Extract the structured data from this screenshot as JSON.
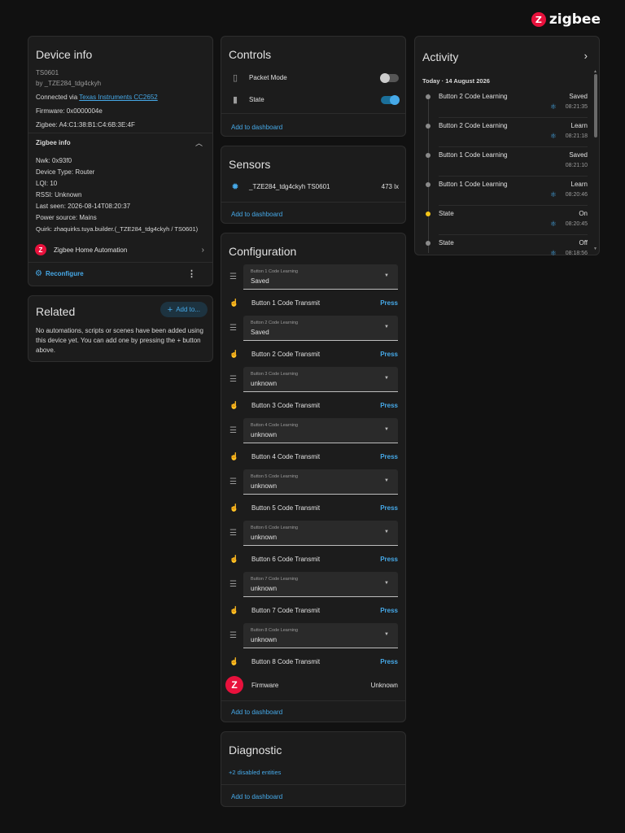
{
  "brand": {
    "name": "zigbee",
    "color": "#e8113c"
  },
  "device_info": {
    "title": "Device info",
    "model": "TS0601",
    "by": "by _TZE284_tdg4ckyh",
    "connected_prefix": "Connected via",
    "connected_link": "Texas Instruments CC2652",
    "firmware": "Firmware: 0x0000004e",
    "zigbee": "Zigbee: A4:C1:38:B1:C4:6B:3E:4F",
    "zigbee_info_label": "Zigbee info",
    "nwk": "Nwk: 0x93f0",
    "device_type": "Device Type: Router",
    "lqi": "LQI: 10",
    "rssi": "RSSI: Unknown",
    "last_seen": "Last seen: 2026-08-14T08:20:37",
    "power_source": "Power source: Mains",
    "quirk": "Quirk: zhaquirks.tuya.builder.(_TZE284_tdg4ckyh / TS0601)",
    "integration": "Zigbee Home Automation",
    "reconfigure": "Reconfigure"
  },
  "related": {
    "title": "Related",
    "add_button": "Add to...",
    "text": "No automations, scripts or scenes have been added using this device yet. You can add one by pressing the + button above."
  },
  "controls": {
    "title": "Controls",
    "items": [
      {
        "label": "Packet Mode",
        "on": false
      },
      {
        "label": "State",
        "on": true
      }
    ],
    "add_to_dashboard": "Add to dashboard"
  },
  "sensors": {
    "title": "Sensors",
    "items": [
      {
        "label": "_TZE284_tdg4ckyh TS0601",
        "value": "473 lx"
      }
    ],
    "add_to_dashboard": "Add to dashboard"
  },
  "configuration": {
    "title": "Configuration",
    "selects": [
      {
        "label": "Button 1 Code Learning",
        "value": "Saved"
      },
      {
        "label": "Button 2 Code Learning",
        "value": "Saved"
      },
      {
        "label": "Button 3 Code Learning",
        "value": "unknown"
      },
      {
        "label": "Button 4 Code Learning",
        "value": "unknown"
      },
      {
        "label": "Button 5 Code Learning",
        "value": "unknown"
      },
      {
        "label": "Button 6 Code Learning",
        "value": "unknown"
      },
      {
        "label": "Button 7 Code Learning",
        "value": "unknown"
      },
      {
        "label": "Button 8 Code Learning",
        "value": "unknown"
      }
    ],
    "transmits": [
      {
        "label": "Button 1 Code Transmit",
        "action": "Press"
      },
      {
        "label": "Button 2 Code Transmit",
        "action": "Press"
      },
      {
        "label": "Button 3 Code Transmit",
        "action": "Press"
      },
      {
        "label": "Button 4 Code Transmit",
        "action": "Press"
      },
      {
        "label": "Button 5 Code Transmit",
        "action": "Press"
      },
      {
        "label": "Button 6 Code Transmit",
        "action": "Press"
      },
      {
        "label": "Button 7 Code Transmit",
        "action": "Press"
      },
      {
        "label": "Button 8 Code Transmit",
        "action": "Press"
      }
    ],
    "firmware_label": "Firmware",
    "firmware_value": "Unknown",
    "add_to_dashboard": "Add to dashboard"
  },
  "diagnostic": {
    "title": "Diagnostic",
    "disabled_entities": "+2 disabled entities",
    "add_to_dashboard": "Add to dashboard"
  },
  "activity": {
    "title": "Activity",
    "date": "Today · 14 August 2026",
    "items": [
      {
        "name": "Button 2 Code Learning",
        "state": "Saved",
        "time": "08:21:35",
        "icon": true,
        "dot": "grey"
      },
      {
        "name": "Button 2 Code Learning",
        "state": "Learn",
        "time": "08:21:18",
        "icon": true,
        "dot": "grey"
      },
      {
        "name": "Button 1 Code Learning",
        "state": "Saved",
        "time": "08:21:10",
        "icon": false,
        "dot": "grey"
      },
      {
        "name": "Button 1 Code Learning",
        "state": "Learn",
        "time": "08:20:46",
        "icon": true,
        "dot": "grey"
      },
      {
        "name": "State",
        "state": "On",
        "time": "08:20:45",
        "icon": true,
        "dot": "yellow"
      },
      {
        "name": "State",
        "state": "Off",
        "time": "08:18:56",
        "icon": true,
        "dot": "grey"
      }
    ]
  }
}
